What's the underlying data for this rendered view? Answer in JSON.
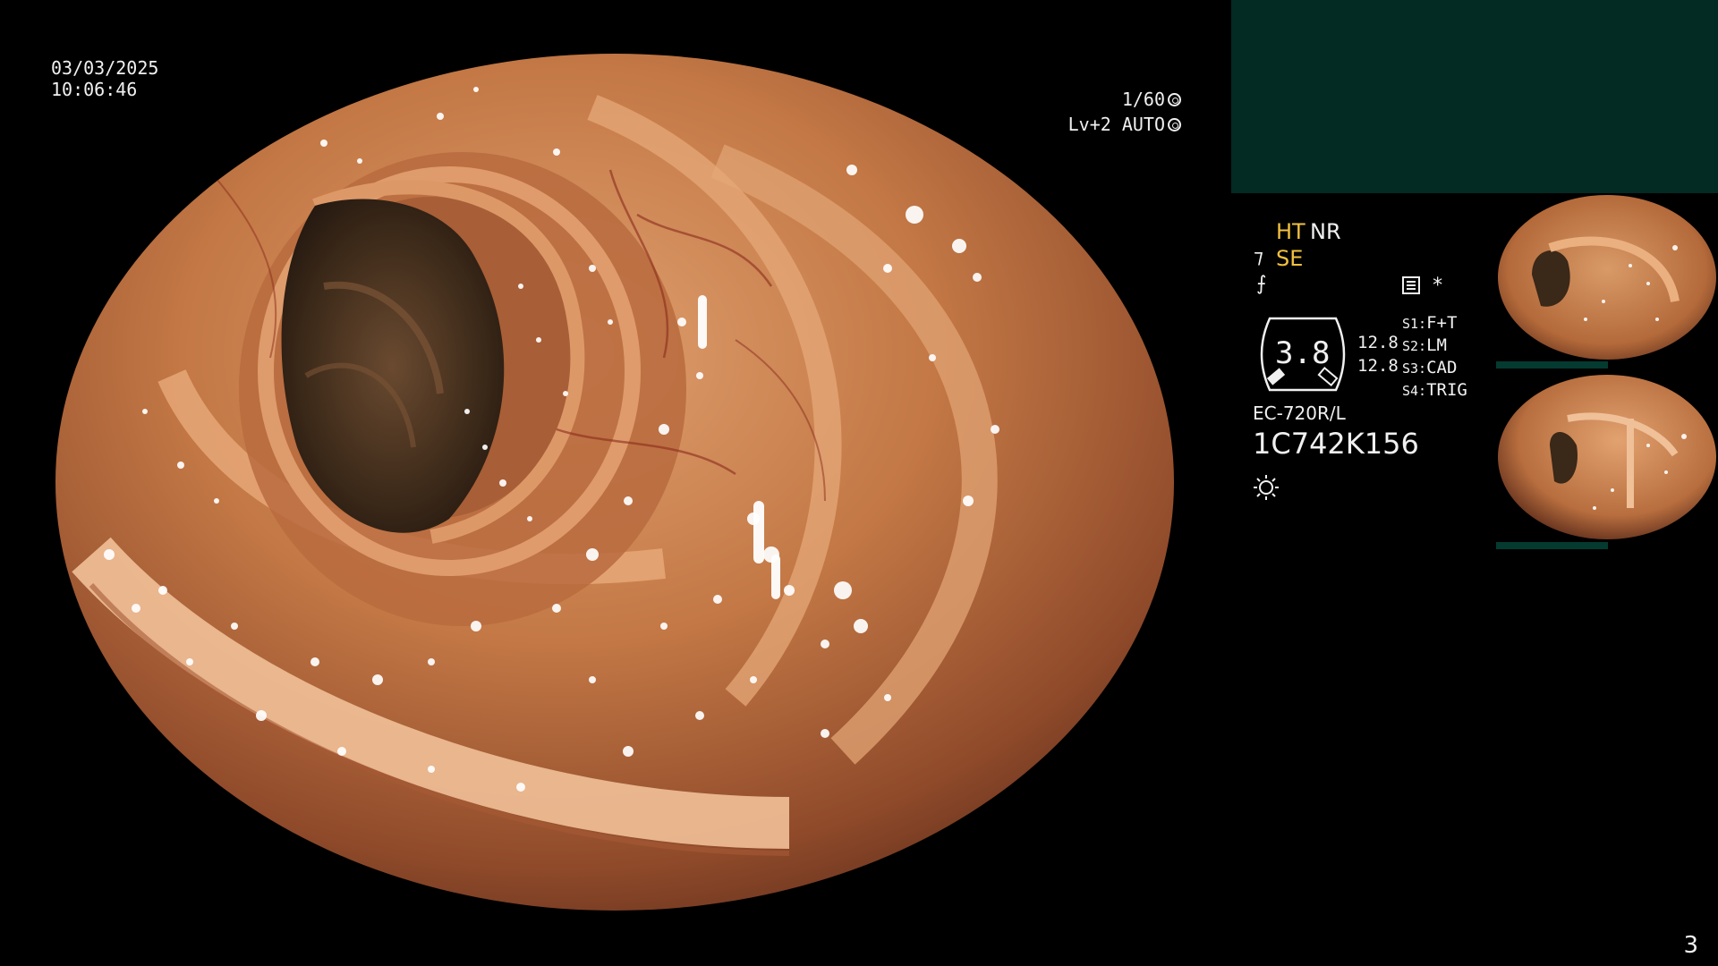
{
  "overlay": {
    "date": "03/03/2025",
    "time": "10:06:46",
    "shutter": "1/60",
    "level": "Lv+2 AUTO"
  },
  "panel": {
    "ht_label": "HT",
    "nr_label": "NR",
    "se_label": "SE",
    "freeze_glyph": "⨍",
    "asterisk": "*",
    "gauge_value": "3.8",
    "gauge_readings": [
      "12.8",
      "12.8"
    ],
    "switches": [
      {
        "key": "S1:",
        "label": "F+T"
      },
      {
        "key": "S2:",
        "label": "LM"
      },
      {
        "key": "S3:",
        "label": "CAD"
      },
      {
        "key": "S4:",
        "label": "TRIG"
      }
    ],
    "scope_model": "EC-720R/L",
    "scope_serial": "1C742K156"
  },
  "thumbnails": [
    {
      "name": "captured-frame-1"
    },
    {
      "name": "captured-frame-2"
    }
  ],
  "page_number": "3",
  "colors": {
    "info_box": "#032a23",
    "highlight_text": "#f2c040",
    "mucosa": "#c97a4a",
    "lumen": "#3a2a1e"
  }
}
